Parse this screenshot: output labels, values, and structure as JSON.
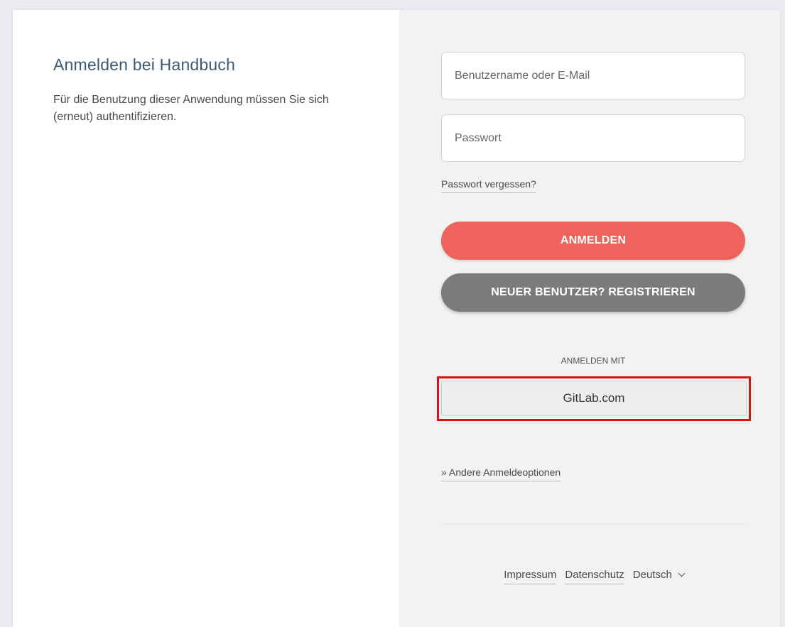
{
  "left": {
    "title": "Anmelden bei Handbuch",
    "description": "Für die Benutzung dieser Anwendung müssen Sie sich (erneut) authentifizieren."
  },
  "form": {
    "username_placeholder": "Benutzername oder E-Mail",
    "password_placeholder": "Passwort",
    "forgot_password": "Passwort vergessen?",
    "login_label": "ANMELDEN",
    "register_label": "NEUER BENUTZER? REGISTRIEREN"
  },
  "external": {
    "heading": "ANMELDEN MIT",
    "providers": [
      "GitLab.com"
    ],
    "other_options": "» Andere Anmeldeoptionen"
  },
  "footer": {
    "imprint": "Impressum",
    "privacy": "Datenschutz",
    "language": "Deutsch",
    "language_icon": "chevron-down-icon"
  },
  "colors": {
    "accent": "#ee635c",
    "secondary": "#7b7b7b",
    "highlight": "#e01010",
    "title": "#3d5a75"
  }
}
